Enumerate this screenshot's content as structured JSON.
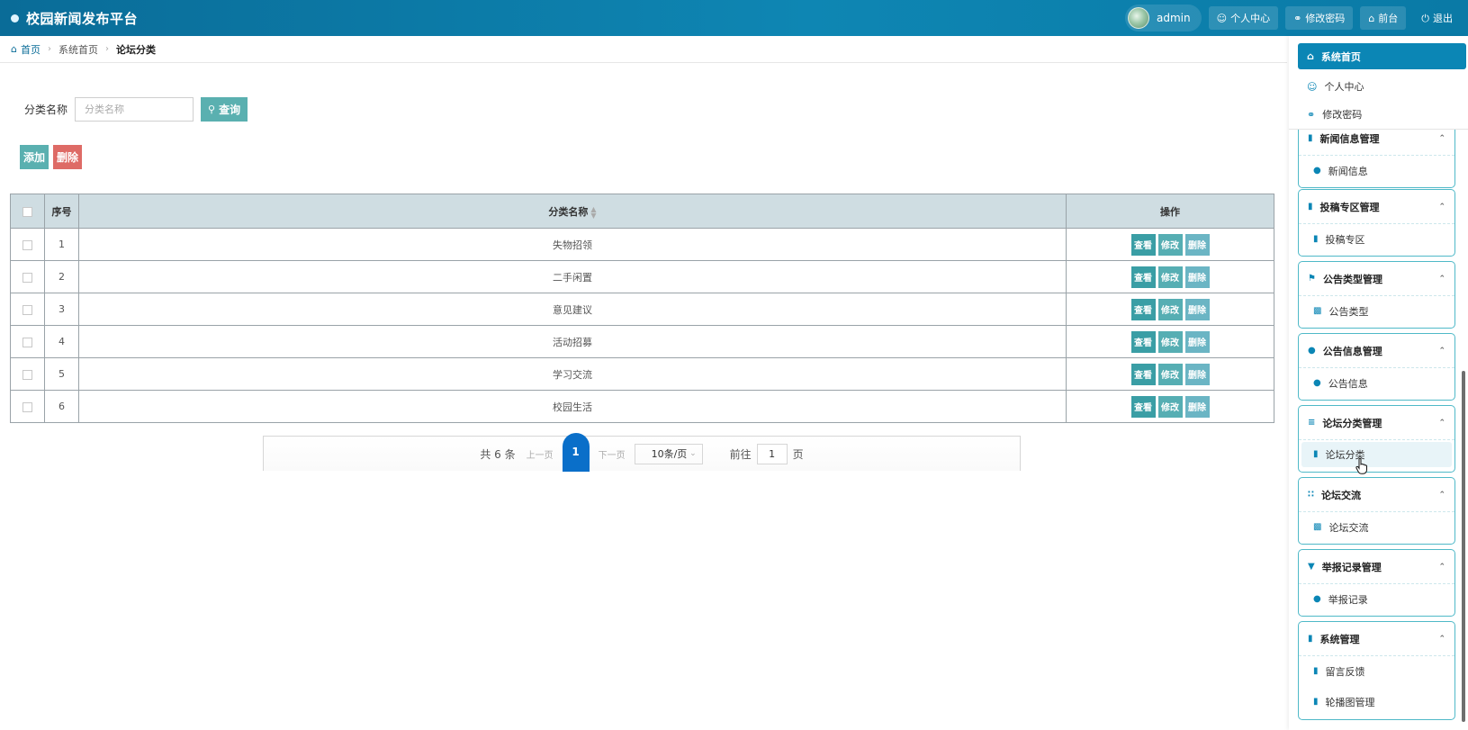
{
  "app": {
    "title": "校园新闻发布平台"
  },
  "header": {
    "user": "admin",
    "personal_center": "个人中心",
    "change_password": "修改密码",
    "front_end": "前台",
    "logout": "退出"
  },
  "breadcrumb": {
    "home": "首页",
    "level1": "系统首页",
    "current": "论坛分类"
  },
  "search": {
    "label": "分类名称",
    "placeholder": "分类名称",
    "value": "",
    "button": "查询"
  },
  "actions": {
    "add": "添加",
    "delete": "删除"
  },
  "table": {
    "headers": {
      "index": "序号",
      "name": "分类名称",
      "ops": "操作"
    },
    "rows": [
      {
        "index": "1",
        "name": "失物招领"
      },
      {
        "index": "2",
        "name": "二手闲置"
      },
      {
        "index": "3",
        "name": "意见建议"
      },
      {
        "index": "4",
        "name": "活动招募"
      },
      {
        "index": "5",
        "name": "学习交流"
      },
      {
        "index": "6",
        "name": "校园生活"
      }
    ],
    "row_ops": {
      "view": "查看",
      "edit": "修改",
      "delete": "删除"
    }
  },
  "pagination": {
    "total": "共 6 条",
    "prev": "上一页",
    "current": "1",
    "next": "下一页",
    "page_size": "10条/页",
    "goto_label": "前往",
    "goto_value": "1",
    "goto_suffix": "页"
  },
  "sidebar": {
    "home": "系统首页",
    "personal_center": "个人中心",
    "change_password": "修改密码",
    "groups": [
      {
        "title": "新闻信息管理",
        "items": [
          "新闻信息"
        ]
      },
      {
        "title": "投稿专区管理",
        "items": [
          "投稿专区"
        ]
      },
      {
        "title": "公告类型管理",
        "items": [
          "公告类型"
        ]
      },
      {
        "title": "公告信息管理",
        "items": [
          "公告信息"
        ]
      },
      {
        "title": "论坛分类管理",
        "items": [
          "论坛分类"
        ]
      },
      {
        "title": "论坛交流",
        "items": [
          "论坛交流"
        ]
      },
      {
        "title": "举报记录管理",
        "items": [
          "举报记录"
        ]
      },
      {
        "title": "系统管理",
        "items": [
          "留言反馈",
          "轮播图管理"
        ]
      }
    ]
  },
  "colors": {
    "primary": "#0b86b5",
    "accent": "#5ab0b0",
    "danger": "#de6b66",
    "page_active": "#0a6fc9"
  }
}
